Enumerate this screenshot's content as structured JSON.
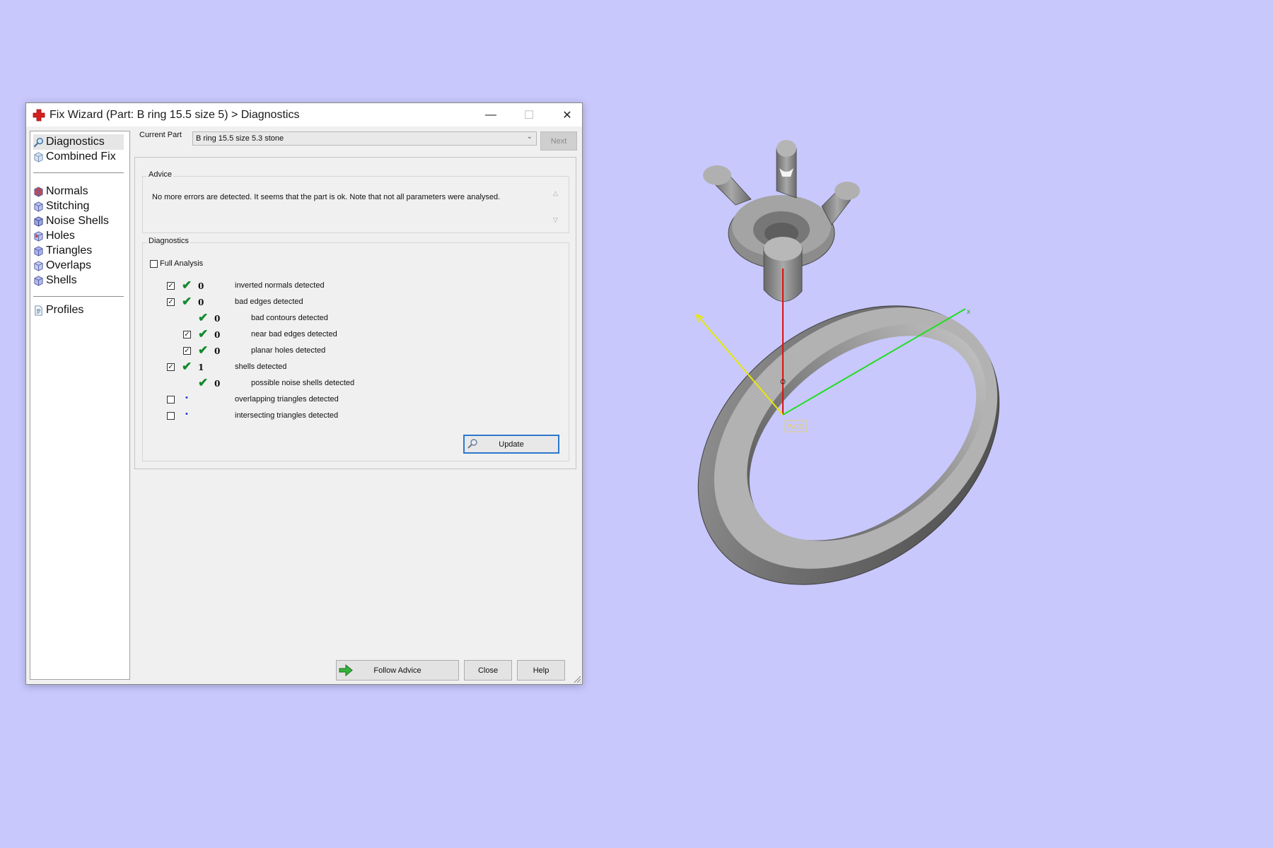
{
  "window": {
    "title": "Fix Wizard (Part: B ring 15.5 size 5) > Diagnostics",
    "minimize_glyph": "—",
    "maximize_glyph": "☐",
    "close_glyph": "✕"
  },
  "nav": {
    "items": [
      {
        "label": "Diagnostics",
        "icon": "magnifier-icon",
        "selected": true
      },
      {
        "label": "Combined Fix",
        "icon": "cube-icon"
      },
      {
        "label": "Normals",
        "icon": "cube-icon"
      },
      {
        "label": "Stitching",
        "icon": "cube-icon"
      },
      {
        "label": "Noise Shells",
        "icon": "cube-icon"
      },
      {
        "label": "Holes",
        "icon": "cube-icon"
      },
      {
        "label": "Triangles",
        "icon": "cube-icon"
      },
      {
        "label": "Overlaps",
        "icon": "cube-icon"
      },
      {
        "label": "Shells",
        "icon": "cube-icon"
      },
      {
        "label": "Profiles",
        "icon": "document-icon"
      }
    ]
  },
  "current_part": {
    "label": "Current Part",
    "value": "B ring 15.5 size 5.3 stone",
    "next_label": "Next"
  },
  "advice": {
    "title": "Advice",
    "text": "No more errors are detected. It seems that the part is ok. Note that not all parameters were analysed."
  },
  "diagnostics": {
    "title": "Diagnostics",
    "full_analysis_label": "Full Analysis",
    "rows": [
      {
        "checked": true,
        "status": "✔",
        "value": "0",
        "label": "inverted normals detected"
      },
      {
        "checked": true,
        "status": "✔",
        "value": "0",
        "label": "bad edges detected"
      },
      {
        "status": "✔",
        "value": "0",
        "label": "bad contours detected"
      },
      {
        "checked": true,
        "status": "✔",
        "value": "0",
        "label": "near bad edges detected"
      },
      {
        "checked": true,
        "status": "✔",
        "value": "0",
        "label": "planar holes detected"
      },
      {
        "checked": true,
        "status": "✔",
        "value": "1",
        "label": "shells detected"
      },
      {
        "status": "✔",
        "value": "0",
        "label": "possible noise shells detected"
      },
      {
        "checked": false,
        "status": "•",
        "label": "overlapping triangles detected"
      },
      {
        "checked": false,
        "status": "•",
        "label": "intersecting triangles detected"
      }
    ],
    "update_label": "Update"
  },
  "buttons": {
    "follow_advice": "Follow Advice",
    "close": "Close",
    "help": "Help"
  },
  "viewport": {
    "background": "#c8c8fd",
    "axis_label": "WCS",
    "x_axis_label": "x"
  },
  "colors": {
    "check_green": "#138a2d",
    "focus_blue": "#2c78cc",
    "axis_x": "#22dd22",
    "axis_y": "#e8e800",
    "axis_z": "#dd1111"
  }
}
